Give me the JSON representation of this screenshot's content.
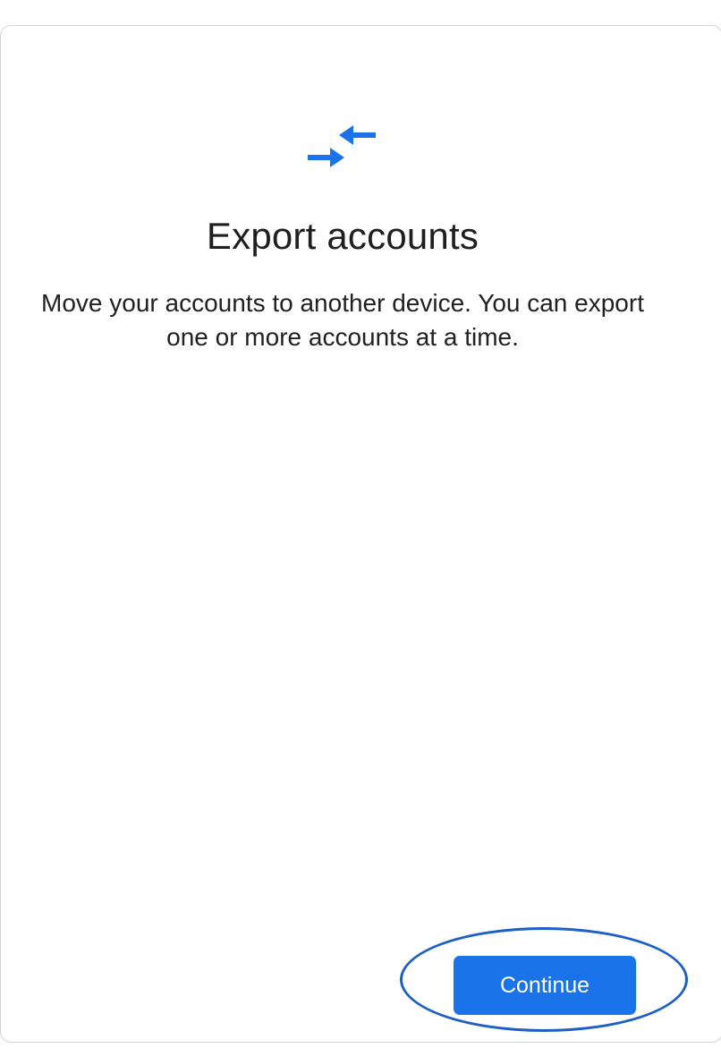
{
  "dialog": {
    "icon": "swap-arrows-icon",
    "title": "Export accounts",
    "description": "Move your accounts to another device. You can export one or more accounts at a time."
  },
  "actions": {
    "continue_label": "Continue"
  },
  "colors": {
    "accent": "#1a73e8",
    "annotation_ring": "#1c5fc6",
    "title_text": "#1f1f1f",
    "border": "#d4d4d4"
  }
}
